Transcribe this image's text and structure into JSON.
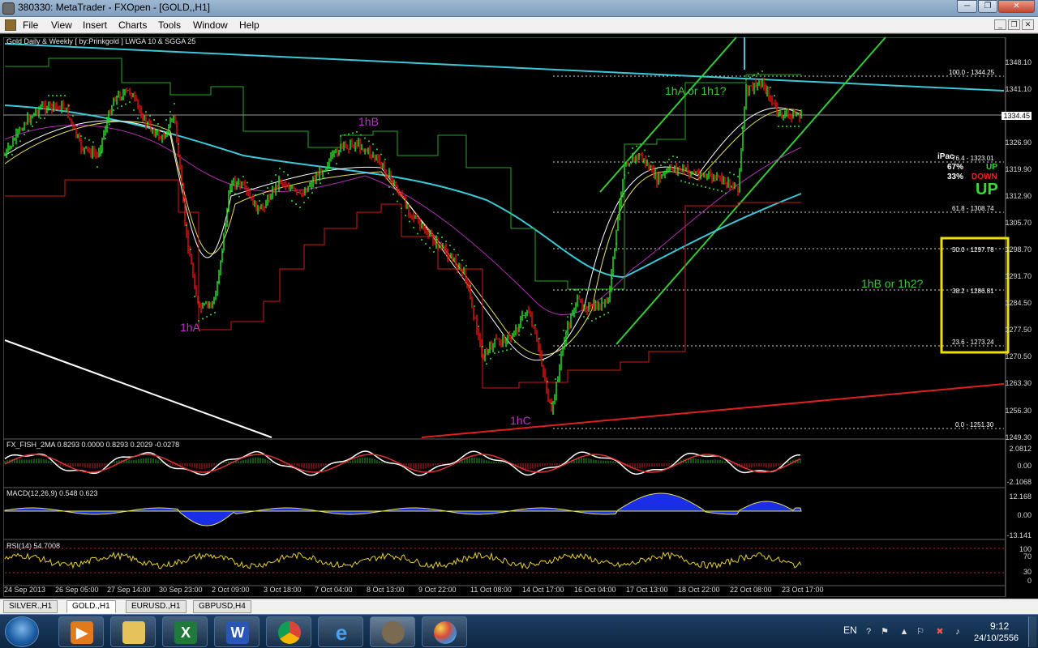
{
  "window": {
    "title": "380330: MetaTrader - FXOpen - [GOLD,,H1]",
    "controls": [
      "─",
      "❐",
      "✕"
    ]
  },
  "menu": {
    "items": [
      "File",
      "View",
      "Insert",
      "Charts",
      "Tools",
      "Window",
      "Help"
    ],
    "mdi_controls": [
      "_",
      "❐",
      "✕"
    ]
  },
  "chart": {
    "title": "Gold Daily & Weekly [ by:Prinkgold ]  LWGA 10  &  SGGA 25",
    "current_price": "1334.45",
    "price_axis": [
      "1348.10",
      "1341.10",
      "1326.90",
      "1319.90",
      "1312.90",
      "1305.70",
      "1298.70",
      "1291.70",
      "1284.50",
      "1277.50",
      "1270.50",
      "1263.30",
      "1256.30",
      "1249.30"
    ],
    "time_axis": [
      "24 Sep 2013",
      "26 Sep 05:00",
      "27 Sep 14:00",
      "30 Sep 23:00",
      "2 Oct 09:00",
      "3 Oct 18:00",
      "7 Oct 04:00",
      "8 Oct 13:00",
      "9 Oct 22:00",
      "11 Oct 08:00",
      "14 Oct 17:00",
      "16 Oct 04:00",
      "17 Oct 13:00",
      "18 Oct 22:00",
      "22 Oct 08:00",
      "23 Oct 17:00"
    ],
    "annotations": {
      "hA": "1hA",
      "hB": "1hB",
      "hC": "1hC",
      "target1": "1hA or 1h1?",
      "target2": "1hB or 1h2?"
    },
    "fib_levels": {
      "l100": "100.0 - 1344.25",
      "l764": "76.4 - 1323.01",
      "l618": "61.8 - 1308.74",
      "l50": "50.0 - 1297.78",
      "l382": "38.2 - 1286.81",
      "l236": "23.6 - 1273.24",
      "l0": "0.0 - 1251.30"
    },
    "ipac": {
      "label": "iPac",
      "up_pct": "67%",
      "down_pct": "33%",
      "up_label": "UP",
      "down_label": "DOWN",
      "signal": "UP"
    },
    "colors": {
      "bull": "#22dd22",
      "bear": "#dd1111",
      "trend": "#33cc33",
      "cyan": "#3cc8d8",
      "box": "#f0e000"
    }
  },
  "indicators": {
    "fisher": {
      "label": "FX_FISH_2MA 0.8293 0.0000 0.8293 0.2029 -0.0278",
      "axis": [
        "2.0812",
        "0.00",
        "-2.1068"
      ]
    },
    "macd": {
      "label": "MACD(12,26,9) 0.548 0.623",
      "axis": [
        "12.168",
        "0.00",
        "-13.141"
      ]
    },
    "rsi": {
      "label": "RSI(14) 54.7008",
      "axis": [
        "100",
        "70",
        "30",
        "0"
      ]
    }
  },
  "tabs": [
    "SILVER.,H1",
    "GOLD.,H1",
    "EURUSD.,H1",
    "GBPUSD,H4"
  ],
  "taskbar": {
    "apps": [
      "media-player",
      "folder",
      "Excel",
      "Word",
      "Chrome",
      "Internet Explorer",
      "MetaTrader",
      "Paint"
    ],
    "language": "EN",
    "time": "9:12",
    "date": "24/10/2556"
  }
}
